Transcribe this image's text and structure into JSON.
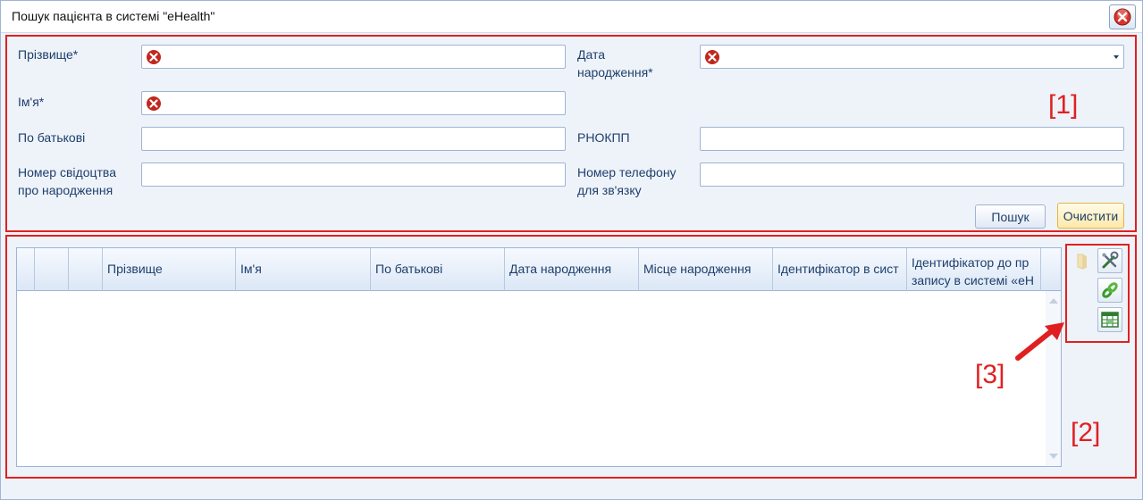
{
  "window": {
    "title": "Пошук пацієнта в системі \"eHealth\""
  },
  "form": {
    "last_name_label": "Прізвище*",
    "first_name_label": "Ім'я*",
    "middle_name_label": "По батькові",
    "birth_cert_label_1": "Номер свідоцтва",
    "birth_cert_label_2": "про народження",
    "birth_date_label_1": "Дата",
    "birth_date_label_2": "народження*",
    "rnokpp_label": "РНОКПП",
    "phone_label_1": "Номер телефону",
    "phone_label_2": "для зв'язку",
    "last_name_value": "",
    "first_name_value": "",
    "middle_name_value": "",
    "birth_cert_value": "",
    "birth_date_value": "",
    "rnokpp_value": "",
    "phone_value": ""
  },
  "buttons": {
    "search": "Пошук",
    "clear": "Очистити"
  },
  "grid": {
    "columns": [
      "",
      "",
      "",
      "Прізвище",
      "Ім'я",
      "По батькові",
      "Дата народження",
      "Місце народження",
      "Ідентифікатор в сист",
      "Ідентифікатор до пр",
      "запису в системі «еН"
    ],
    "rows": []
  },
  "toolbar": {
    "icons": [
      "folder-icon",
      "settings-tools-icon",
      "link-icon",
      "export-excel-icon"
    ]
  },
  "annotations": {
    "region_1": "[1]",
    "region_2": "[2]",
    "region_3": "[3]"
  },
  "colors": {
    "annotation_red": "#e02020",
    "error_icon_red": "#c0281e",
    "accent_blue": "#1e3f6b",
    "active_button_yellow": "#fde9a9"
  }
}
